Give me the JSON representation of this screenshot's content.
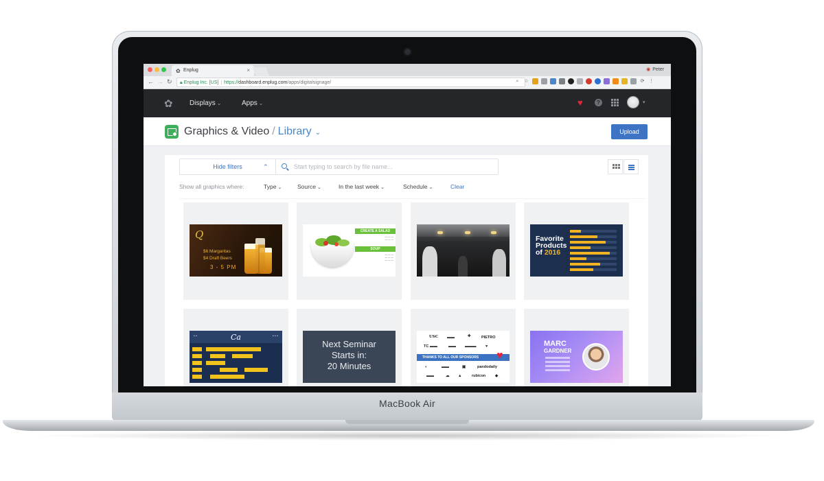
{
  "device": {
    "brand_label": "MacBook Air"
  },
  "browser": {
    "tab_title": "Enplug",
    "profile_name": "Peter",
    "url_org": "Enplug Inc. [US]",
    "url_protocol": "https://",
    "url_host": "dashboard.enplug.com",
    "url_path": "/apps/digitalsignage/"
  },
  "navbar": {
    "items": [
      {
        "label": "Displays"
      },
      {
        "label": "Apps"
      }
    ]
  },
  "header": {
    "title": "Graphics & Video",
    "breadcrumb": "Library",
    "upload_label": "Upload"
  },
  "filters": {
    "hide_label": "Hide filters",
    "search_placeholder": "Start typing to search by file name...",
    "lead": "Show all graphics where:",
    "items": [
      "Type",
      "Source",
      "In the last week",
      "Schedule"
    ],
    "clear_label": "Clear"
  },
  "tiles": {
    "t1": {
      "line1": "$6 Margaritas",
      "line2": "$4 Draft Beers",
      "time": "3 - 5 PM"
    },
    "t2": {
      "bar1": "CREATE A SALAD",
      "bar2": "SOUP"
    },
    "t4": {
      "line1": "Favorite",
      "line2": "Products",
      "of": "of ",
      "year": "2016"
    },
    "t6": {
      "line1": "Next Seminar",
      "line2": "Starts in:",
      "line3": "20 Minutes"
    },
    "t7": {
      "band": "THANKS TO ALL OUR SPONSORS",
      "logos": [
        "USC",
        "PIETRO",
        "pandodaily",
        "rubicon"
      ]
    },
    "t8": {
      "first": "MARC",
      "last": "GARDNER"
    }
  }
}
